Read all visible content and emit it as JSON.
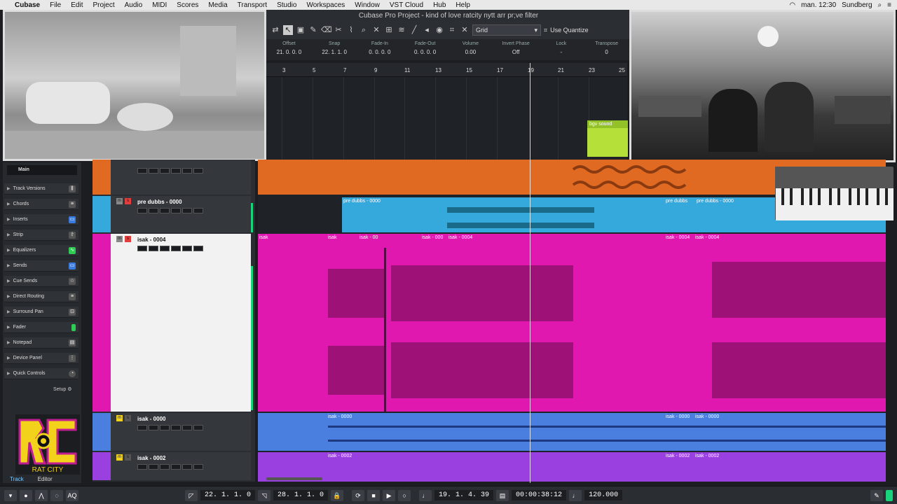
{
  "menubar": {
    "items": [
      "Cubase",
      "File",
      "Edit",
      "Project",
      "Audio",
      "MIDI",
      "Scores",
      "Media",
      "Transport",
      "Studio",
      "Workspaces",
      "Window",
      "VST Cloud",
      "Hub",
      "Help"
    ],
    "clock": "man. 12:30",
    "user": "Sundberg"
  },
  "window_title": "Cubase Pro Project - kind of love ratcity nytt arr pr;ve filter",
  "toolbar": {
    "grid_label": "Grid",
    "use_quantize_label": "Use Quantize"
  },
  "infoline": [
    {
      "label": "Offset",
      "value": "21. 0. 0. 0"
    },
    {
      "label": "Snap",
      "value": "22. 1. 1. 0"
    },
    {
      "label": "Fade-In",
      "value": "0. 0. 0. 0"
    },
    {
      "label": "Fade-Out",
      "value": "0. 0. 0. 0"
    },
    {
      "label": "Volume",
      "value": "0.00"
    },
    {
      "label": "Invert Phase",
      "value": "Off"
    },
    {
      "label": "Lock",
      "value": "-"
    },
    {
      "label": "Transpose",
      "value": "0"
    }
  ],
  "ruler_ticks": [
    "3",
    "5",
    "7",
    "9",
    "11",
    "13",
    "15",
    "17",
    "19",
    "21",
    "23",
    "25"
  ],
  "upper_event": {
    "label": "bgv sound"
  },
  "inspector": {
    "main_label": "Main",
    "sections": [
      "Track Versions",
      "Chords",
      "Inserts",
      "Strip",
      "Equalizers",
      "Sends",
      "Cue Sends",
      "Direct Routing",
      "Surround Pan",
      "Fader",
      "Notepad",
      "Device Panel",
      "Quick Controls"
    ],
    "setup_label": "Setup",
    "tabs": [
      "Track",
      "Editor"
    ]
  },
  "tracks": [
    {
      "name": "pre dubbs - 0000",
      "color": "#35a8dc",
      "events": [
        "pre dubbs - 0000",
        "pre dubbs",
        "pre dubbs - 0000"
      ]
    },
    {
      "name": "isak - 0004",
      "color": "#e018b0",
      "events": [
        "isak",
        "isak - 00",
        "isak - 000",
        "isak - 0004",
        "isak - 0004",
        "isak - 0004"
      ]
    },
    {
      "name": "isak - 0000",
      "color": "#4a7fe0",
      "events": [
        "isak - 0000",
        "isak - 0000",
        "isak - 0000"
      ]
    },
    {
      "name": "isak - 0002",
      "color": "#9a40e0",
      "events": [
        "isak - 0002",
        "isak - 0002",
        "isak - 0002"
      ]
    }
  ],
  "logo": {
    "line1": "RAT CITY"
  },
  "transport": {
    "left_locator": "22. 1. 1. 0",
    "right_locator": "28. 1. 1. 0",
    "position_bars": "19. 1. 4. 39",
    "position_time": "00:00:38:12",
    "tempo": "120.000",
    "aq_label": "AQ"
  }
}
